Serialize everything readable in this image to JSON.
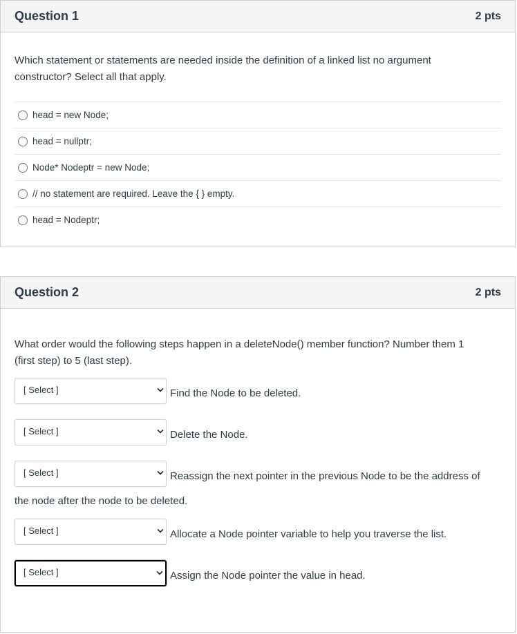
{
  "questions": [
    {
      "title": "Question 1",
      "points": "2 pts",
      "text": "Which statement or statements are needed inside the definition of a linked list no argument constructor?  Select all that apply.",
      "answers": [
        "head = new Node;",
        "head = nullptr;",
        "Node* Nodeptr = new Node;",
        "// no statement are required. Leave the { } empty.",
        "head = Nodeptr;"
      ]
    },
    {
      "title": "Question 2",
      "points": "2 pts",
      "text": "What order would the following steps happen in a deleteNode() member function?  Number them 1 (first step) to 5 (last step).",
      "steps": [
        {
          "selected": "[ Select ]",
          "label": "Find the Node to be deleted."
        },
        {
          "selected": "[ Select ]",
          "label": "Delete the Node."
        },
        {
          "selected": "[ Select ]",
          "label": "Reassign the next pointer in the previous Node to be the address of",
          "continuation": "the node after the node to be deleted."
        },
        {
          "selected": "[ Select ]",
          "label": "Allocate a Node pointer variable to help you traverse the list."
        },
        {
          "selected": "[ Select ]",
          "label": "Assign the Node pointer the value in head."
        }
      ]
    }
  ]
}
